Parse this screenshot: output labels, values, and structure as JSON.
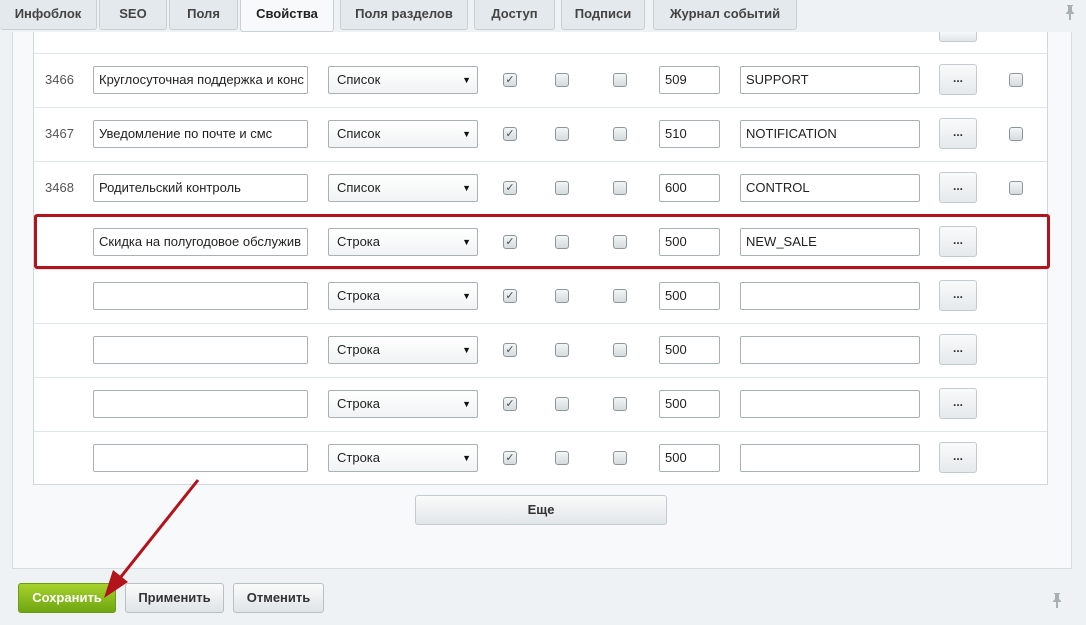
{
  "tabs": [
    "Инфоблок",
    "SEO",
    "Поля",
    "Свойства",
    "Поля разделов",
    "Доступ",
    "Подписи",
    "Журнал событий"
  ],
  "active_tab": "Свойства",
  "rows": [
    {
      "id": "3466",
      "name": "Круглосуточная поддержка и конс",
      "type": "Список",
      "checks": [
        true,
        false,
        false
      ],
      "sort": "509",
      "code": "SUPPORT",
      "more": "...",
      "del": true
    },
    {
      "id": "3467",
      "name": "Уведомление по почте и смс",
      "type": "Список",
      "checks": [
        true,
        false,
        false
      ],
      "sort": "510",
      "code": "NOTIFICATION",
      "more": "...",
      "del": true
    },
    {
      "id": "3468",
      "name": "Родительский контроль",
      "type": "Список",
      "checks": [
        true,
        false,
        false
      ],
      "sort": "600",
      "code": "CONTROL",
      "more": "...",
      "del": true
    },
    {
      "id": "",
      "name": "Скидка на полугодовое обслужив",
      "type": "Строка",
      "checks": [
        true,
        false,
        false
      ],
      "sort": "500",
      "code": "NEW_SALE",
      "more": "...",
      "del": false
    },
    {
      "id": "",
      "name": "",
      "type": "Строка",
      "checks": [
        true,
        false,
        false
      ],
      "sort": "500",
      "code": "",
      "more": "...",
      "del": false
    },
    {
      "id": "",
      "name": "",
      "type": "Строка",
      "checks": [
        true,
        false,
        false
      ],
      "sort": "500",
      "code": "",
      "more": "...",
      "del": false
    },
    {
      "id": "",
      "name": "",
      "type": "Строка",
      "checks": [
        true,
        false,
        false
      ],
      "sort": "500",
      "code": "",
      "more": "...",
      "del": false
    },
    {
      "id": "",
      "name": "",
      "type": "Строка",
      "checks": [
        true,
        false,
        false
      ],
      "sort": "500",
      "code": "",
      "more": "...",
      "del": false
    }
  ],
  "more_rows_label": "Еще",
  "footer": {
    "save": "Сохранить",
    "apply": "Применить",
    "cancel": "Отменить"
  },
  "colors": {
    "highlight": "#b3131b",
    "save_button": "#7db51a",
    "annotation_arrow": "#b3131b"
  }
}
